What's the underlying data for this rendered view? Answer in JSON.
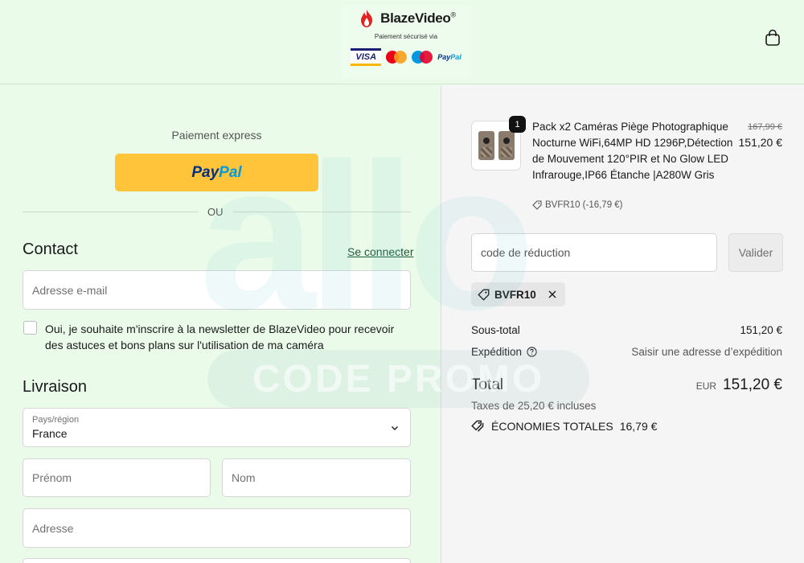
{
  "header": {
    "brand": "BlazeVideo",
    "brand_mark": "®",
    "secure_text": "Paiement sécurisé via",
    "payment_logos": [
      "visa",
      "mastercard",
      "maestro",
      "paypal"
    ],
    "visa_text": "VISA",
    "paypal_small_a": "Pay",
    "paypal_small_b": "Pal",
    "cart_icon": "shopping-bag-icon"
  },
  "express": {
    "label": "Paiement express",
    "paypal_a": "Pay",
    "paypal_b": "Pal",
    "divider_text": "OU"
  },
  "contact": {
    "title": "Contact",
    "login_link": "Se connecter",
    "email_placeholder": "Adresse e-mail",
    "newsletter_label": "Oui, je souhaite m'inscrire à la newsletter de BlazeVideo pour recevoir des astuces et bons plans sur l'utilisation de ma caméra",
    "newsletter_checked": false
  },
  "delivery": {
    "title": "Livraison",
    "country_label": "Pays/région",
    "country_value": "France",
    "first_name_placeholder": "Prénom",
    "last_name_placeholder": "Nom",
    "address_placeholder": "Adresse"
  },
  "order": {
    "item": {
      "quantity": "1",
      "title": "Pack x2 Caméras Piège Photographique Nocturne WiFi,64MP HD 1296P,Détection de Mouvement 120°PIR et No Glow LED Infrarouge,IP66 Étanche |A280W Gris",
      "discount": "BVFR10 (-16,79 €)",
      "old_price": "167,99 €",
      "price": "151,20 €"
    },
    "code_placeholder": "code de réduction",
    "apply_label": "Valider",
    "applied_code": "BVFR10",
    "subtotal_label": "Sous-total",
    "subtotal_value": "151,20 €",
    "shipping_label": "Expédition",
    "shipping_value": "Saisir une adresse d’expédition",
    "total_label": "Total",
    "currency": "EUR",
    "total_value": "151,20 €",
    "taxes": "Taxes de 25,20 € incluses",
    "savings_label": "ÉCONOMIES TOTALES",
    "savings_value": "16,79 €"
  },
  "watermark": {
    "word": "allo",
    "band": "CODE PROMO"
  },
  "colors": {
    "page_bg": "#eafbea",
    "summary_bg": "#f5f5f5",
    "paypal_yellow": "#ffc439",
    "paypal_blue": "#003087",
    "paypal_light_blue": "#009cde",
    "link_green": "#1a5b3a",
    "brand_red": "#e02424"
  }
}
